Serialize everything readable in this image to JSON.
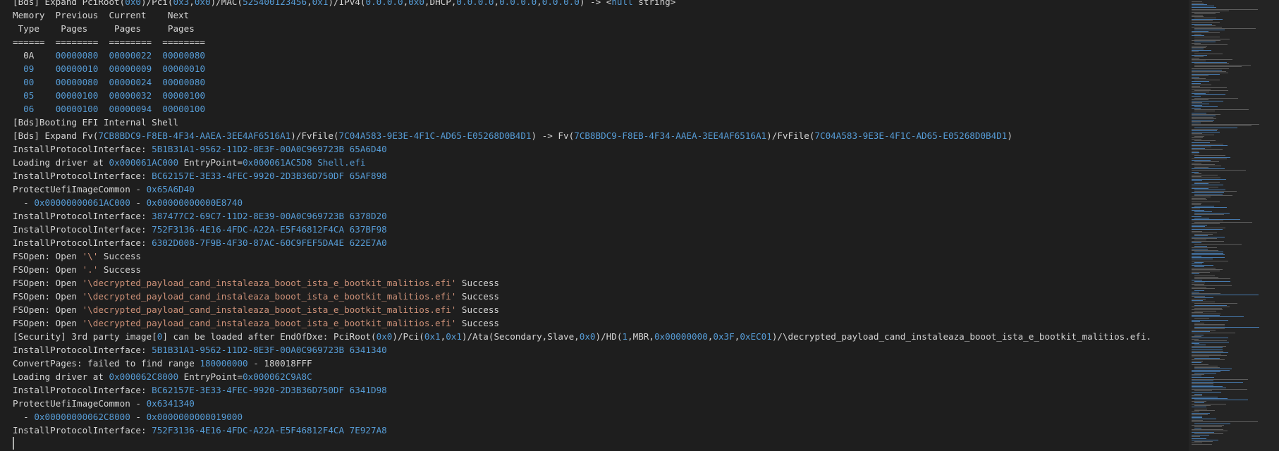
{
  "colors": {
    "background": "#1e1e1e",
    "text": "#d4d4d4",
    "number": "#569cd6",
    "string": "#ce9178"
  },
  "lines": [
    [
      [
        "p",
        "[Bds] Expand PciRoot("
      ],
      [
        "n",
        "0x0"
      ],
      [
        "p",
        ")/Pci("
      ],
      [
        "n",
        "0x3"
      ],
      [
        "p",
        ","
      ],
      [
        "n",
        "0x0"
      ],
      [
        "p",
        ")/MAC("
      ],
      [
        "n",
        "525400123456"
      ],
      [
        "p",
        ","
      ],
      [
        "n",
        "0x1"
      ],
      [
        "p",
        ")/IPv4("
      ],
      [
        "n",
        "0.0.0.0"
      ],
      [
        "p",
        ","
      ],
      [
        "n",
        "0x0"
      ],
      [
        "p",
        ",DHCP,"
      ],
      [
        "n",
        "0.0.0.0"
      ],
      [
        "p",
        ","
      ],
      [
        "n",
        "0.0.0.0"
      ],
      [
        "p",
        ","
      ],
      [
        "n",
        "0.0.0.0"
      ],
      [
        "p",
        ") -> <"
      ],
      [
        "n",
        "null"
      ],
      [
        "p",
        " string>"
      ]
    ],
    [
      [
        "p",
        "Memory  Previous  Current    Next"
      ]
    ],
    [
      [
        "p",
        " Type    Pages     Pages     Pages"
      ]
    ],
    [
      [
        "p",
        "======  ========  ========  ========"
      ]
    ],
    [
      [
        "p",
        "  0A    "
      ],
      [
        "n",
        "00000080"
      ],
      [
        "p",
        "  "
      ],
      [
        "n",
        "00000022"
      ],
      [
        "p",
        "  "
      ],
      [
        "n",
        "00000080"
      ]
    ],
    [
      [
        "p",
        "  "
      ],
      [
        "n",
        "09"
      ],
      [
        "p",
        "    "
      ],
      [
        "n",
        "00000010"
      ],
      [
        "p",
        "  "
      ],
      [
        "n",
        "00000009"
      ],
      [
        "p",
        "  "
      ],
      [
        "n",
        "00000010"
      ]
    ],
    [
      [
        "p",
        "  "
      ],
      [
        "n",
        "00"
      ],
      [
        "p",
        "    "
      ],
      [
        "n",
        "00000080"
      ],
      [
        "p",
        "  "
      ],
      [
        "n",
        "00000024"
      ],
      [
        "p",
        "  "
      ],
      [
        "n",
        "00000080"
      ]
    ],
    [
      [
        "p",
        "  "
      ],
      [
        "n",
        "05"
      ],
      [
        "p",
        "    "
      ],
      [
        "n",
        "00000100"
      ],
      [
        "p",
        "  "
      ],
      [
        "n",
        "00000032"
      ],
      [
        "p",
        "  "
      ],
      [
        "n",
        "00000100"
      ]
    ],
    [
      [
        "p",
        "  "
      ],
      [
        "n",
        "06"
      ],
      [
        "p",
        "    "
      ],
      [
        "n",
        "00000100"
      ],
      [
        "p",
        "  "
      ],
      [
        "n",
        "00000094"
      ],
      [
        "p",
        "  "
      ],
      [
        "n",
        "00000100"
      ]
    ],
    [
      [
        "p",
        "[Bds]Booting EFI Internal Shell"
      ]
    ],
    [
      [
        "p",
        "[Bds] Expand Fv("
      ],
      [
        "n",
        "7CB8BDC9-F8EB-4F34-AAEA-3EE4AF6516A1"
      ],
      [
        "p",
        ")/FvFile("
      ],
      [
        "n",
        "7C04A583-9E3E-4F1C-AD65-E05268D0B4D1"
      ],
      [
        "p",
        ") -> Fv("
      ],
      [
        "n",
        "7CB8BDC9-F8EB-4F34-AAEA-3EE4AF6516A1"
      ],
      [
        "p",
        ")/FvFile("
      ],
      [
        "n",
        "7C04A583-9E3E-4F1C-AD65-E05268D0B4D1"
      ],
      [
        "p",
        ")"
      ]
    ],
    [
      [
        "p",
        "InstallProtocolInterface: "
      ],
      [
        "n",
        "5B1B31A1-9562-11D2-8E3F-00A0C969723B 65A6D40"
      ]
    ],
    [
      [
        "p",
        "Loading driver at "
      ],
      [
        "n",
        "0x000061AC000"
      ],
      [
        "p",
        " EntryPoint="
      ],
      [
        "n",
        "0x000061AC5D8 Shell.efi"
      ]
    ],
    [
      [
        "p",
        "InstallProtocolInterface: "
      ],
      [
        "n",
        "BC62157E-3E33-4FEC-9920-2D3B36D750DF 65AF898"
      ]
    ],
    [
      [
        "p",
        "ProtectUefiImageCommon - "
      ],
      [
        "n",
        "0x65A6D40"
      ]
    ],
    [
      [
        "p",
        "  - "
      ],
      [
        "n",
        "0x00000000061AC000"
      ],
      [
        "p",
        " - "
      ],
      [
        "n",
        "0x00000000000E8740"
      ]
    ],
    [
      [
        "p",
        "InstallProtocolInterface: "
      ],
      [
        "n",
        "387477C2-69C7-11D2-8E39-00A0C969723B 6378D20"
      ]
    ],
    [
      [
        "p",
        "InstallProtocolInterface: "
      ],
      [
        "n",
        "752F3136-4E16-4FDC-A22A-E5F46812F4CA 637BF98"
      ]
    ],
    [
      [
        "p",
        "InstallProtocolInterface: "
      ],
      [
        "n",
        "6302D008-7F9B-4F30-87AC-60C9FEF5DA4E 622E7A0"
      ]
    ],
    [
      [
        "p",
        "FSOpen: Open "
      ],
      [
        "s",
        "'\\'"
      ],
      [
        "p",
        " Success"
      ]
    ],
    [
      [
        "p",
        "FSOpen: Open "
      ],
      [
        "s",
        "'.'"
      ],
      [
        "p",
        " Success"
      ]
    ],
    [
      [
        "p",
        "FSOpen: Open "
      ],
      [
        "s",
        "'\\decrypted_payload_cand_instaleaza_booot_ista_e_bootkit_malitios.efi'"
      ],
      [
        "p",
        " Success"
      ]
    ],
    [
      [
        "p",
        "FSOpen: Open "
      ],
      [
        "s",
        "'\\decrypted_payload_cand_instaleaza_booot_ista_e_bootkit_malitios.efi'"
      ],
      [
        "p",
        " Success"
      ]
    ],
    [
      [
        "p",
        "FSOpen: Open "
      ],
      [
        "s",
        "'\\decrypted_payload_cand_instaleaza_booot_ista_e_bootkit_malitios.efi'"
      ],
      [
        "p",
        " Success"
      ]
    ],
    [
      [
        "p",
        "FSOpen: Open "
      ],
      [
        "s",
        "'\\decrypted_payload_cand_instaleaza_booot_ista_e_bootkit_malitios.efi'"
      ],
      [
        "p",
        " Success"
      ]
    ],
    [
      [
        "p",
        "[Security] 3rd party image["
      ],
      [
        "n",
        "0"
      ],
      [
        "p",
        "] can be loaded after EndOfDxe: PciRoot("
      ],
      [
        "n",
        "0x0"
      ],
      [
        "p",
        ")/Pci("
      ],
      [
        "n",
        "0x1"
      ],
      [
        "p",
        ","
      ],
      [
        "n",
        "0x1"
      ],
      [
        "p",
        ")/Ata(Secondary,Slave,"
      ],
      [
        "n",
        "0x0"
      ],
      [
        "p",
        ")/HD("
      ],
      [
        "n",
        "1"
      ],
      [
        "p",
        ",MBR,"
      ],
      [
        "n",
        "0x00000000"
      ],
      [
        "p",
        ","
      ],
      [
        "n",
        "0x3F"
      ],
      [
        "p",
        ","
      ],
      [
        "n",
        "0xEC01"
      ],
      [
        "p",
        ")/\\decrypted_payload_cand_instaleaza_booot_ista_e_bootkit_malitios.efi."
      ]
    ],
    [
      [
        "p",
        "InstallProtocolInterface: "
      ],
      [
        "n",
        "5B1B31A1-9562-11D2-8E3F-00A0C969723B 6341340"
      ]
    ],
    [
      [
        "p",
        "ConvertPages: failed to find range "
      ],
      [
        "n",
        "180000000"
      ],
      [
        "p",
        " - 180018FFF"
      ]
    ],
    [
      [
        "p",
        "Loading driver at "
      ],
      [
        "n",
        "0x000062C8000"
      ],
      [
        "p",
        " EntryPoint="
      ],
      [
        "n",
        "0x000062C9A8C"
      ]
    ],
    [
      [
        "p",
        "InstallProtocolInterface: "
      ],
      [
        "n",
        "BC62157E-3E33-4FEC-9920-2D3B36D750DF 6341D98"
      ]
    ],
    [
      [
        "p",
        "ProtectUefiImageCommon - "
      ],
      [
        "n",
        "0x6341340"
      ]
    ],
    [
      [
        "p",
        "  - "
      ],
      [
        "n",
        "0x00000000062C8000"
      ],
      [
        "p",
        " - "
      ],
      [
        "n",
        "0x0000000000019000"
      ]
    ],
    [
      [
        "p",
        "InstallProtocolInterface: "
      ],
      [
        "n",
        "752F3136-4E16-4FDC-A22A-E5F46812F4CA 7E927A8"
      ]
    ]
  ]
}
